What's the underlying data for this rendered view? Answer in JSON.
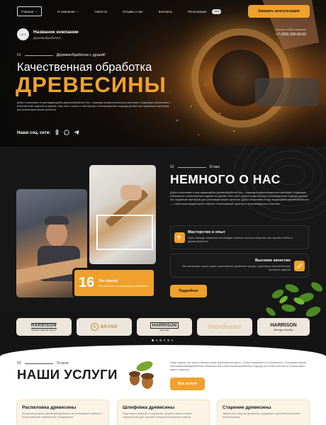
{
  "colors": {
    "accent": "#f0a12c",
    "dark": "#141414",
    "light": "#ffffff"
  },
  "nav": {
    "items": [
      {
        "label": "Главная",
        "dropdown": true
      },
      {
        "label": "О компании",
        "dropdown": true
      },
      {
        "label": "Новости"
      },
      {
        "label": "Отзывы о нас"
      },
      {
        "label": "Контакты"
      },
      {
        "label": "Регистрация"
      }
    ],
    "badge": "new",
    "cta_label": "Заказать консультацию"
  },
  "hero": {
    "logo_text": "LOGO",
    "company_name": "Название компании",
    "company_sub": "Деревообработка",
    "contact_label": "Горячая линия компании",
    "contact_phone": "+7 (000) 000-00-00",
    "number": "01",
    "tag": "Деревообработка с душой!",
    "title_line1": "Качественная обработка",
    "title_line2": "ДРЕВЕСИНЫ",
    "description": "Добро пожаловать в мир выдающейся деревообработки! Мы – команда профессиональных умельцев, создающих уникальные и качественные изделия из дерева. Наш опыт, страсть к мастерству и инновационные подходы делают нас надежным партнером для реализации ваших проектов.",
    "socials_label": "Наши соц. сети:",
    "social_icons": [
      "ok-icon",
      "whatsapp-icon",
      "telegram-icon"
    ]
  },
  "about": {
    "number": "02",
    "tag": "О нас",
    "title": "НЕМНОГО О НАС",
    "description": "Добро пожаловать в мир выдающейся деревообработки! Мы – команда профессиональных умельцев, создающих уникальные и качественные изделия из дерева. Наш опыт, страсть к мастерству и инновационные подходы делают нас надежным партнером для реализации ваших проектов. Добро пожаловать в мир выдающейся деревообработки — с нами ваш каждый проект обретет неповторимый характер и непревзойденное качество!",
    "badge_number": "16",
    "badge_title": "Лет опыта!",
    "badge_sub": "Мы работаем на рынке деревообработки",
    "features": [
      {
        "title": "Мастерство и опыт",
        "desc": "Наша команда специалистов обладает богатым опытом в искусстве мастерства в области деревообработки",
        "icon": "hammer-icon"
      },
      {
        "title": "Высокое качество",
        "desc": "Мы используем только самые качественные древесные породы, гарантируя исключительную прочность изделий",
        "icon": "saw-icon"
      }
    ],
    "more_label": "Подробнее"
  },
  "brands": [
    {
      "name": "HARRISON",
      "sub": "ORIGINAL GENUINE QUALITY"
    },
    {
      "name": "BRAND",
      "sub": ""
    },
    {
      "name": "HARRISON",
      "sub": "ESTD 2020"
    },
    {
      "name": "brandname",
      "sub": ""
    },
    {
      "name": "HARRISON",
      "sub": "design studio"
    }
  ],
  "carousel": {
    "total": 6,
    "active": 0
  },
  "services": {
    "number": "03",
    "tag": "Услуги",
    "title": "НАШИ УСЛУГИ",
    "description": "Наши задачи: мы просто решаем ваши проблемы как здесь, чтобы показывать их в реальность. Благодаря нашим высококвалифицированным специалистам и персонализированному подходу мы готовы воплотить в жизнь ваши идеи и замыслы.",
    "button_label": "Все услуги",
    "cards": [
      {
        "title": "Распиловка древесины",
        "desc": "Профессиональная распиловка древесины на необходимые размеры с использованием современного оборудования."
      },
      {
        "title": "Шлифовка древесины",
        "desc": "Подготовка к покраске и сохранение лучшей отделки к нашим специалистам дает лучший и безупречный результат работы."
      },
      {
        "title": "Старение древесины",
        "desc": "Эффектное старение древесины, придающее изделиям уникальный винтажный вид."
      }
    ]
  }
}
